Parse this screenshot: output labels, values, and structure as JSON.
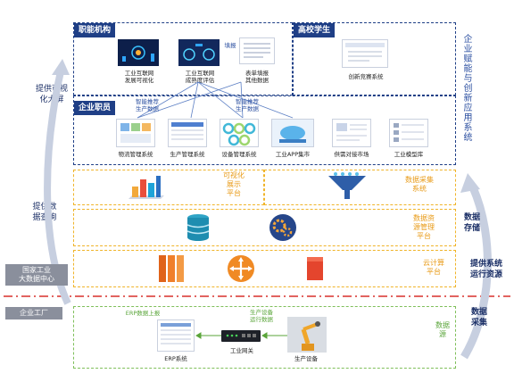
{
  "left_labels": {
    "big_screen": "提供可视\n化大屏",
    "data_query": "提供数\n据查询",
    "national_center": "国家工业\n大数据中心",
    "factory": "企业工厂"
  },
  "right_labels": {
    "enterprise_apps": "企业赋能与创新应用系统",
    "data_storage": "数据\n存储",
    "runtime": "提供系统\n运行资源",
    "data_collection": "数据\n采集"
  },
  "top_section": {
    "functional_title": "职能机构",
    "students_title": "高校学生",
    "employees_title": "企业职员",
    "items": [
      {
        "label": "工业互联网\n发展可视化"
      },
      {
        "label": "工业互联网\n成熟度评估"
      },
      {
        "label": "表单填报\n其他数据"
      },
      {
        "label": "创新竞赛系统"
      }
    ],
    "report_label": "填报",
    "arrow_labels": [
      "智能推荐\n生产数据",
      "智能推荐\n生产数据"
    ],
    "systems": [
      {
        "label": "物流管理系统"
      },
      {
        "label": "生产管理系统"
      },
      {
        "label": "设备管理系统"
      },
      {
        "label": "工业APP集市"
      },
      {
        "label": "供需对接市场"
      },
      {
        "label": "工业模型库"
      }
    ]
  },
  "middle_section": {
    "visual_platform": "可视化\n展示\n平台",
    "data_collect_system": "数据采集\n系统",
    "data_resource_platform": "数据资\n源管理\n平台",
    "cloud_platform": "云计算\n平台"
  },
  "bottom_section": {
    "erp_upload": "ERP数据上报",
    "device_status": "生产设备\n运行数据",
    "erp_system": "ERP系统",
    "gateway": "工业网关",
    "production_device": "生产设备",
    "data_source": "数据\n源"
  },
  "colors": {
    "navy": "#1f3f86",
    "orange": "#f0b429",
    "green": "#7fbf5a",
    "red": "#d9312b"
  }
}
